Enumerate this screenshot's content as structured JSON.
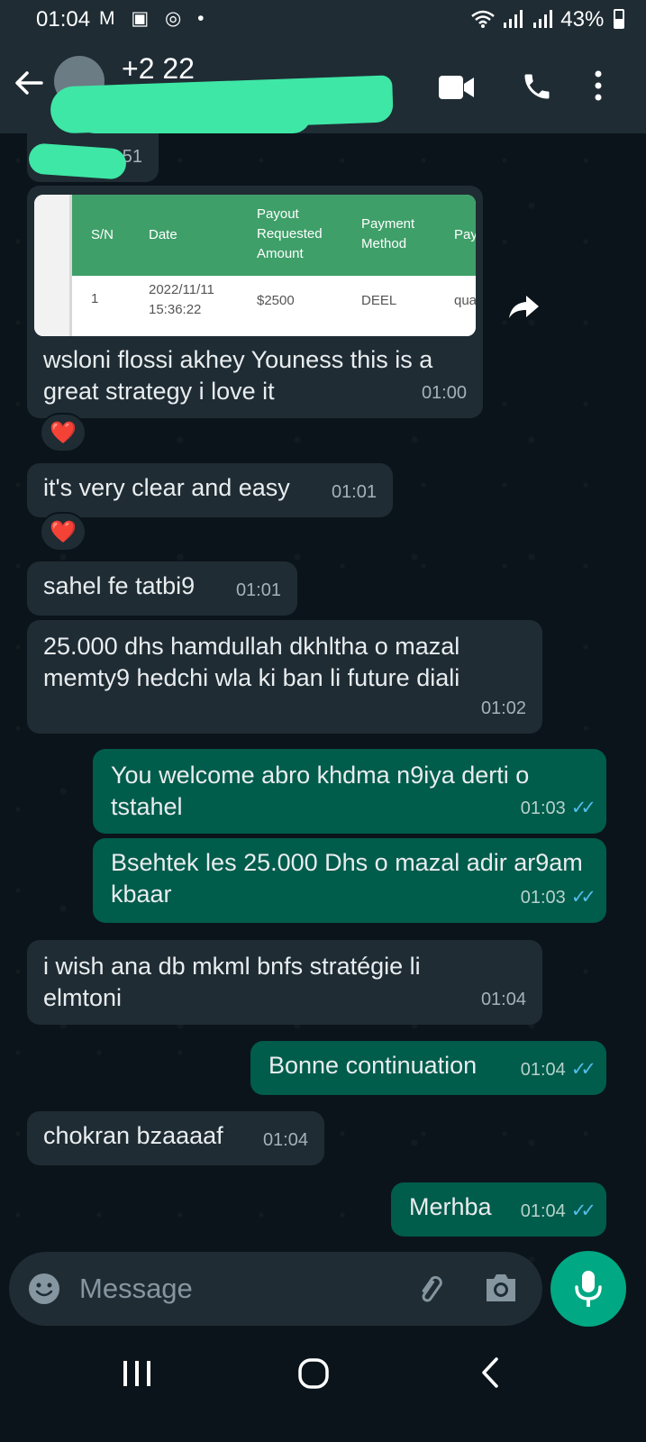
{
  "status": {
    "time": "01:04",
    "left_icons": "M ▣ ◎ •",
    "battery": "43%"
  },
  "header": {
    "contact_name": "+2                  22"
  },
  "table": {
    "headers": [
      "S/N",
      "Date",
      "Payout Requested Amount",
      "Payment Method",
      "Pay"
    ],
    "row": [
      "1",
      "2022/11/11 15:36:22",
      "$2500",
      "DEEL",
      "qua"
    ]
  },
  "messages": [
    {
      "id": "partial",
      "dir": "in",
      "text": "",
      "time": "51"
    },
    {
      "id": "m1",
      "dir": "in",
      "text": "wsloni flossi akhey Youness this is a great strategy i love it",
      "time": "01:00",
      "reaction": "❤️"
    },
    {
      "id": "m2",
      "dir": "in",
      "text": "it's very clear and easy",
      "time": "01:01",
      "reaction": "❤️"
    },
    {
      "id": "m3",
      "dir": "in",
      "text": "sahel fe tatbi9",
      "time": "01:01"
    },
    {
      "id": "m4",
      "dir": "in",
      "text": "25.000 dhs hamdullah dkhltha o mazal memty9 hedchi wla ki ban li future diali",
      "time": "01:02"
    },
    {
      "id": "m5",
      "dir": "out",
      "text": "You welcome abro khdma n9iya derti o tstahel",
      "time": "01:03"
    },
    {
      "id": "m6",
      "dir": "out",
      "text": "Bsehtek les 25.000 Dhs o mazal adir ar9am kbaar",
      "time": "01:03"
    },
    {
      "id": "m7",
      "dir": "in",
      "text": "i wish ana db mkml bnfs stratégie li elmtoni",
      "time": "01:04"
    },
    {
      "id": "m8",
      "dir": "out",
      "text": "Bonne continuation",
      "time": "01:04"
    },
    {
      "id": "m9",
      "dir": "in",
      "text": "chokran bzaaaaf",
      "time": "01:04"
    },
    {
      "id": "m10",
      "dir": "out",
      "text": "Merhba",
      "time": "01:04"
    }
  ],
  "input": {
    "placeholder": "Message"
  },
  "colors": {
    "background": "#0b141a",
    "incoming": "#1f2c34",
    "outgoing": "#005c4b",
    "accent": "#00a884",
    "read_ticks": "#53bdeb"
  }
}
